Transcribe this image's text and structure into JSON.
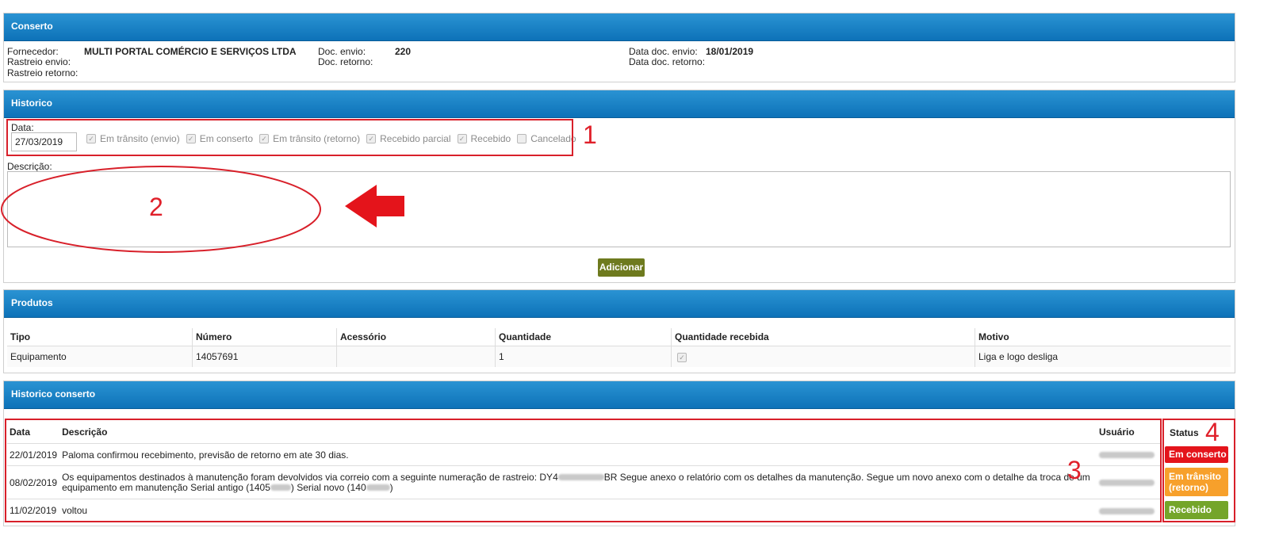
{
  "conserto": {
    "title": "Conserto",
    "fornecedor_label": "Fornecedor:",
    "fornecedor_value": "MULTI PORTAL COMÉRCIO E SERVIÇOS LTDA",
    "rastreio_envio_label": "Rastreio envio:",
    "rastreio_retorno_label": "Rastreio retorno:",
    "doc_envio_label": "Doc. envio:",
    "doc_envio_value": "220",
    "doc_retorno_label": "Doc. retorno:",
    "data_doc_envio_label": "Data doc. envio:",
    "data_doc_envio_value": "18/01/2019",
    "data_doc_retorno_label": "Data doc. retorno:"
  },
  "historico": {
    "title": "Historico",
    "data_label": "Data:",
    "data_value": "27/03/2019",
    "checkboxes": [
      {
        "label": "Em trânsito (envio)",
        "checked": true
      },
      {
        "label": "Em conserto",
        "checked": true
      },
      {
        "label": "Em trânsito (retorno)",
        "checked": true
      },
      {
        "label": "Recebido parcial",
        "checked": true
      },
      {
        "label": "Recebido",
        "checked": true
      },
      {
        "label": "Cancelado",
        "checked": false
      }
    ],
    "descricao_label": "Descrição:",
    "add_button": "Adicionar"
  },
  "annotations": {
    "n1": "1",
    "n2": "2",
    "n3": "3",
    "n4": "4"
  },
  "produtos": {
    "title": "Produtos",
    "headers": [
      "Tipo",
      "Número",
      "Acessório",
      "Quantidade",
      "Quantidade recebida",
      "Motivo"
    ],
    "row": {
      "tipo": "Equipamento",
      "numero": "14057691",
      "acessorio": "",
      "quantidade": "1",
      "quantidade_recebida_checked": true,
      "motivo": "Liga e logo desliga"
    }
  },
  "historico_conserto": {
    "title": "Historico conserto",
    "headers": {
      "data": "Data",
      "descricao": "Descrição",
      "usuario": "Usuário",
      "status": "Status"
    },
    "rows": [
      {
        "data": "22/01/2019",
        "descricao": "Paloma confirmou recebimento, previsão de retorno em ate 30 dias.",
        "status": "Em conserto",
        "status_color": "#e4141b"
      },
      {
        "data": "08/02/2019",
        "descricao_a": "Os equipamentos destinados à manutenção foram devolvidos via correio com a seguinte numeração de rastreio: DY4",
        "descricao_b": "BR Segue anexo o relatório com os detalhes da manutenção. Segue um novo anexo com o detalhe da troca de um",
        "descricao_c": "equipamento em manutenção Serial antigo (1405",
        "descricao_d": ") Serial novo (140",
        "descricao_e": ")",
        "status": "Em trânsito (retorno)",
        "status_color": "#f7a02b"
      },
      {
        "data": "11/02/2019",
        "descricao": "voltou",
        "status": "Recebido",
        "status_color": "#74a52a"
      }
    ]
  }
}
